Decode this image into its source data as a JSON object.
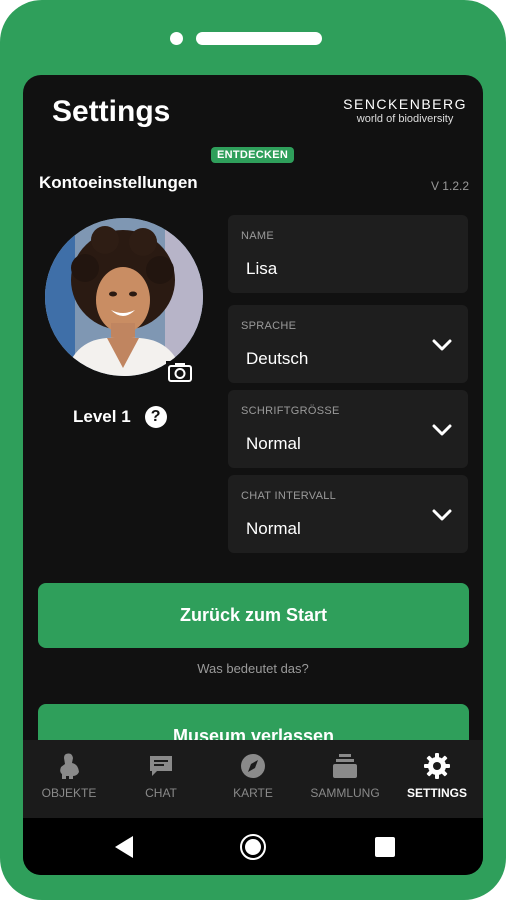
{
  "header": {
    "title": "Settings"
  },
  "logo": {
    "name": "SENCKENBERG",
    "tagline": "world of biodiversity"
  },
  "badge": {
    "label": "ENTDECKEN"
  },
  "account": {
    "section_title": "Kontoeinstellungen",
    "version": "V 1.2.2"
  },
  "profile": {
    "level_label": "Level 1",
    "help_symbol": "?"
  },
  "fields": {
    "name": {
      "label": "NAME",
      "value": "Lisa"
    },
    "language": {
      "label": "SPRACHE",
      "value": "Deutsch"
    },
    "font_size": {
      "label": "SCHRIFTGRÖSSE",
      "value": "Normal"
    },
    "chat_interval": {
      "label": "CHAT INTERVALL",
      "value": "Normal"
    }
  },
  "buttons": {
    "back_to_start": "Zurück zum Start",
    "leave_museum": "Museum verlassen"
  },
  "hint": {
    "text": "Was bedeutet das?"
  },
  "tabs": [
    {
      "label": "OBJEKTE",
      "icon": "dinosaur-icon",
      "active": false
    },
    {
      "label": "CHAT",
      "icon": "chat-icon",
      "active": false
    },
    {
      "label": "KARTE",
      "icon": "compass-icon",
      "active": false
    },
    {
      "label": "SAMMLUNG",
      "icon": "collection-icon",
      "active": false
    },
    {
      "label": "SETTINGS",
      "icon": "gear-icon",
      "active": true
    }
  ],
  "colors": {
    "accent": "#2f9f5b",
    "background": "#111111",
    "field": "#1e1e1e"
  }
}
